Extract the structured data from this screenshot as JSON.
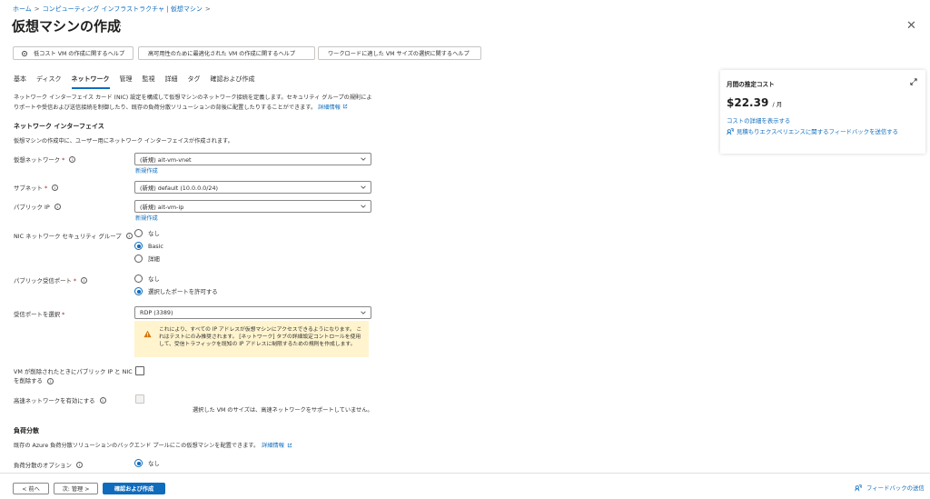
{
  "breadcrumb": {
    "home": "ホーム",
    "separator": ">",
    "section": "コンピューティング インフラストラクチャ | 仮想マシン"
  },
  "page": {
    "title": "仮想マシンの作成",
    "more": "…",
    "close": "✕"
  },
  "help_buttons": [
    "低コスト VM の作成に関するヘルプ",
    "高可用性のために最適化された VM の作成に関するヘルプ",
    "ワークロードに適した VM サイズの選択に関するヘルプ"
  ],
  "tabs": [
    "基本",
    "ディスク",
    "ネットワーク",
    "管理",
    "監視",
    "詳細",
    "タグ",
    "確認および作成"
  ],
  "active_tab": "ネットワーク",
  "intro": {
    "text": "ネットワーク インターフェイス カード (NIC) 設定を構成して仮想マシンのネットワーク接続を定義します。セキュリティ グループの規則によりポートや受信および送信接続を制御したり、既存の負荷分散ソリューションの背後に配置したりすることができます。",
    "learn_more": "詳細情報"
  },
  "nic_section": {
    "title": "ネットワーク インターフェイス",
    "description": "仮想マシンの作成中に、ユーザー用にネットワーク インターフェイスが作成されます。"
  },
  "fields": {
    "vnet": {
      "label": "仮想ネットワーク",
      "required": "*",
      "value": "(新規) ait-vm-vnet",
      "create_new": "新規作成"
    },
    "subnet": {
      "label": "サブネット",
      "required": "*",
      "value": "(新規) default (10.0.0.0/24)"
    },
    "public_ip": {
      "label": "パブリック IP",
      "value": "(新規) ait-vm-ip",
      "create_new": "新規作成"
    },
    "nsg": {
      "label": "NIC ネットワーク セキュリティ グループ",
      "options": [
        "なし",
        "Basic",
        "詳細"
      ],
      "selected": "Basic"
    },
    "inbound": {
      "label": "パブリック受信ポート",
      "required": "*",
      "options": [
        "なし",
        "選択したポートを許可する"
      ],
      "selected": "選択したポートを許可する"
    },
    "select_ports": {
      "label": "受信ポートを選択",
      "required": "*",
      "value": "RDP (3389)"
    },
    "warning": "これにより、すべての IP アドレスが仮想マシンにアクセスできるようになります。 これはテストにのみ推奨されます。 [ネットワーク] タブの詳細設定コントロールを使用して、受信トラフィックを既知の IP アドレスに制限するための規則を作成します。",
    "delete_with_vm": {
      "label_line1": "VM が削除されたときにパブリック IP と NIC",
      "label_line2": "を削除する",
      "checked": false
    },
    "accel": {
      "label": "高速ネットワークを有効にする",
      "note": "選択した VM のサイズは、高速ネットワークをサポートしていません。"
    }
  },
  "lb_section": {
    "title": "負荷分散",
    "description": "既存の Azure 負荷分散ソリューションのバックエンド プールにこの仮想マシンを配置できます。",
    "learn_more": "詳細情報",
    "option_label": "負荷分散のオプション",
    "options": [
      "なし"
    ],
    "selected": "なし"
  },
  "cost": {
    "title": "月間の推定コスト",
    "value": "$22.39",
    "unit": "/ 月",
    "details_link": "コストの詳細を表示する",
    "feedback_link": "見積もりエクスペリエンスに関するフィードバックを送信する"
  },
  "footer": {
    "prev": "< 前へ",
    "next": "次: 管理 >",
    "review": "確認および作成",
    "feedback": "フィードバックの送信"
  },
  "colors": {
    "accent": "#0f6cbd",
    "warning_bg": "#fff4ce",
    "warning_icon": "#d47500",
    "required": "#a4262c"
  }
}
